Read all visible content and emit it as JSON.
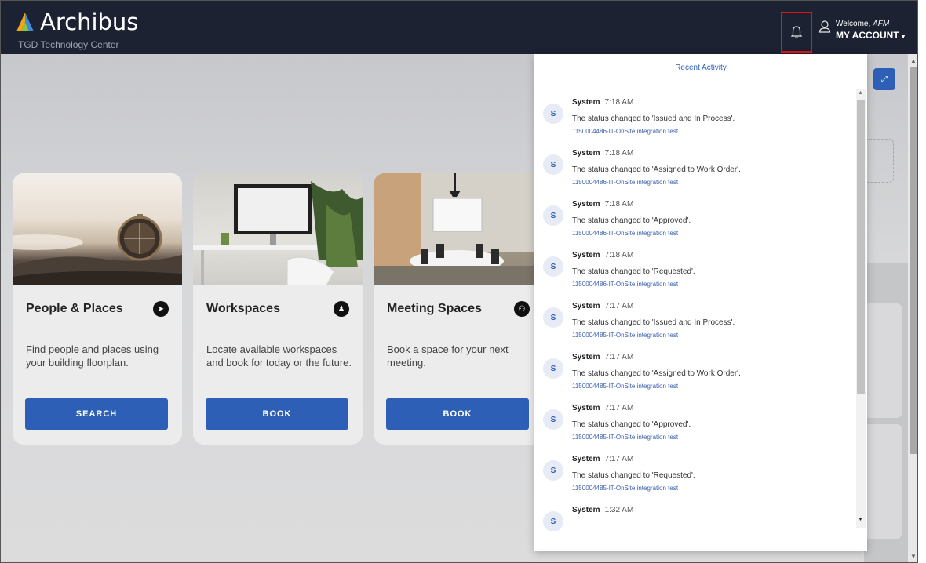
{
  "header": {
    "app_name": "Archibus",
    "site_name": "TGD Technology Center",
    "welcome_prefix": "Welcome,",
    "user_name": "AFM",
    "account_label": "MY ACCOUNT",
    "brand_color": "#1d2233",
    "accent_color": "#e0141b"
  },
  "cards": [
    {
      "title": "People & Places",
      "icon": "cursor-icon",
      "description": "Find people and places using your building floorplan.",
      "button": "SEARCH"
    },
    {
      "title": "Workspaces",
      "icon": "chair-icon",
      "description": "Locate available workspaces and book for today or the future.",
      "button": "BOOK"
    },
    {
      "title": "Meeting Spaces",
      "icon": "meeting-table-icon",
      "description": "Book a space for your next meeting.",
      "button": "BOOK"
    }
  ],
  "activity": {
    "title": "Recent Activity",
    "items": [
      {
        "initial": "S",
        "user": "System",
        "time": "7:18 AM",
        "message": "The status changed to 'Issued and In Process'.",
        "link": "1150004486-IT-OnSite integration test"
      },
      {
        "initial": "S",
        "user": "System",
        "time": "7:18 AM",
        "message": "The status changed to 'Assigned to Work Order'.",
        "link": "1150004486-IT-OnSite integration test"
      },
      {
        "initial": "S",
        "user": "System",
        "time": "7:18 AM",
        "message": "The status changed to 'Approved'.",
        "link": "1150004486-IT-OnSite integration test"
      },
      {
        "initial": "S",
        "user": "System",
        "time": "7:18 AM",
        "message": "The status changed to 'Requested'.",
        "link": "1150004486-IT-OnSite integration test"
      },
      {
        "initial": "S",
        "user": "System",
        "time": "7:17 AM",
        "message": "The status changed to 'Issued and In Process'.",
        "link": "1150004485-IT-OnSite integration test"
      },
      {
        "initial": "S",
        "user": "System",
        "time": "7:17 AM",
        "message": "The status changed to 'Assigned to Work Order'.",
        "link": "1150004485-IT-OnSite integration test"
      },
      {
        "initial": "S",
        "user": "System",
        "time": "7:17 AM",
        "message": "The status changed to 'Approved'.",
        "link": "1150004485-IT-OnSite integration test"
      },
      {
        "initial": "S",
        "user": "System",
        "time": "7:17 AM",
        "message": "The status changed to 'Requested'.",
        "link": "1150004485-IT-OnSite integration test"
      },
      {
        "initial": "S",
        "user": "System",
        "time": "1:32 AM",
        "message": "",
        "link": ""
      }
    ]
  }
}
